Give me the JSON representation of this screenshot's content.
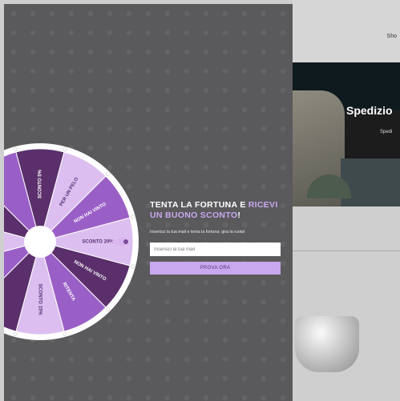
{
  "store": {
    "nav_text": "Sho",
    "hero_title": "Spedizio",
    "hero_subtitle": "Spedi"
  },
  "popup": {
    "headline_part1": "TENTA LA FORTUNA E ",
    "headline_accent1": "RICEVI",
    "headline_accent2": "UN BUONO SCONTO",
    "headline_end": "!",
    "subtext": "Inserisci la tua mail e tenta la fortuna: gira la ruota!",
    "email_placeholder": "Inserisci la tua mail",
    "button_label": "PROVA ORA",
    "accent_color": "#c9a8ef"
  },
  "wheel": {
    "segments": [
      {
        "label": "SCONTO 20%",
        "color": "#dcbff0",
        "text_color": "#5a2f7a"
      },
      {
        "label": "NON HAI VINTO",
        "color": "#5a2f6b",
        "text_color": "#ffffff"
      },
      {
        "label": "RITENTA",
        "color": "#9a5fc6",
        "text_color": "#ffffff"
      },
      {
        "label": "SCONTO 15%",
        "color": "#dcbff0",
        "text_color": "#5a2f7a"
      },
      {
        "label": "",
        "color": "#5a2f6b",
        "text_color": "#ffffff"
      },
      {
        "label": "",
        "color": "#9a5fc6",
        "text_color": "#ffffff"
      },
      {
        "label": "",
        "color": "#dcbff0",
        "text_color": "#5a2f7a"
      },
      {
        "label": "",
        "color": "#5a2f6b",
        "text_color": "#ffffff"
      },
      {
        "label": "",
        "color": "#9a5fc6",
        "text_color": "#ffffff"
      },
      {
        "label": "SCONTO 5%",
        "color": "#5a2f6b",
        "text_color": "#ffffff"
      },
      {
        "label": "PER UN PELO",
        "color": "#dcbff0",
        "text_color": "#5a2f7a"
      },
      {
        "label": "NON HAI VINTO",
        "color": "#9a5fc6",
        "text_color": "#ffffff"
      }
    ]
  }
}
